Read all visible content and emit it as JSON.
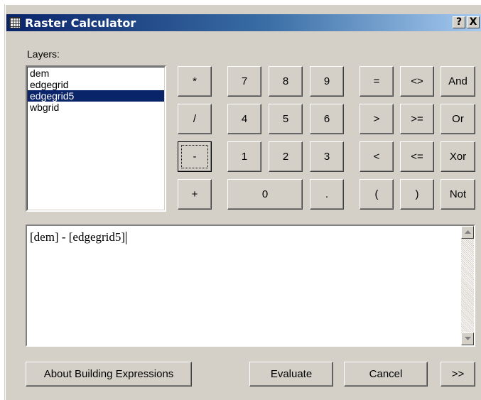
{
  "window": {
    "title": "Raster Calculator",
    "help_button": "?",
    "close_button": "X"
  },
  "layers": {
    "label": "Layers:",
    "items": [
      "dem",
      "edgegrid",
      "edgegrid5",
      "wbgrid"
    ],
    "selected": "edgegrid5"
  },
  "operators": [
    "*",
    "/",
    "-",
    "+"
  ],
  "digits": {
    "row1": [
      "7",
      "8",
      "9"
    ],
    "row2": [
      "4",
      "5",
      "6"
    ],
    "row3": [
      "1",
      "2",
      "3"
    ],
    "zero": "0",
    "dot": "."
  },
  "comparisons": {
    "row1": [
      "=",
      "<>",
      "And"
    ],
    "row2": [
      ">",
      ">=",
      "Or"
    ],
    "row3": [
      "<",
      "<=",
      "Xor"
    ],
    "row4": [
      "(",
      ")",
      "Not"
    ]
  },
  "expression": "[dem] - [edgegrid5]",
  "buttons": {
    "about": "About Building Expressions",
    "evaluate": "Evaluate",
    "cancel": "Cancel",
    "more": ">>"
  }
}
